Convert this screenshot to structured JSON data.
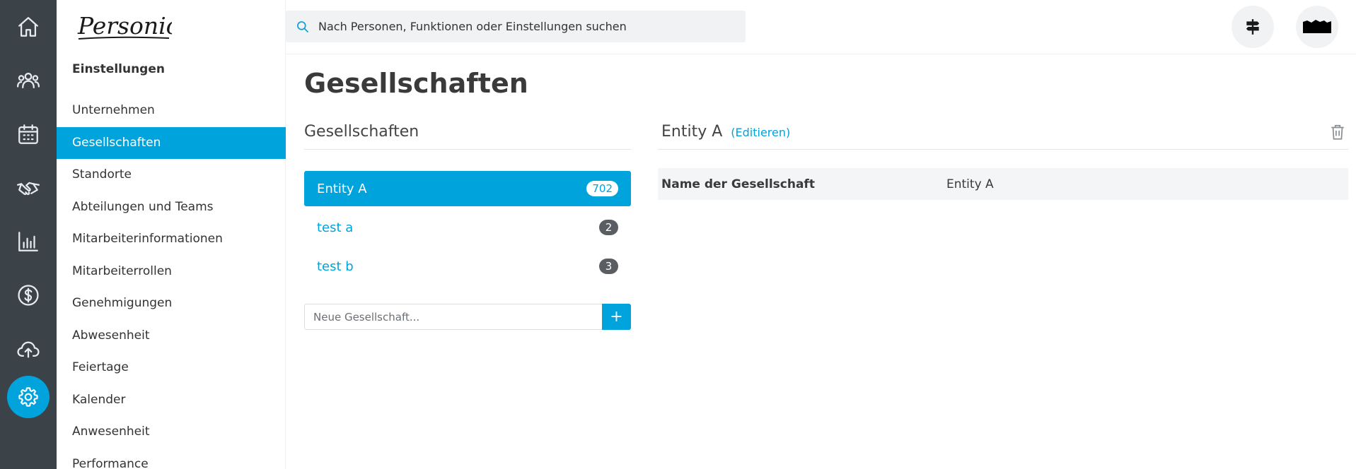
{
  "brand": {
    "name": "Personio"
  },
  "rail": [
    {
      "icon": "home-icon"
    },
    {
      "icon": "people-icon"
    },
    {
      "icon": "calendar-icon"
    },
    {
      "icon": "handshake-icon"
    },
    {
      "icon": "bar-chart-icon"
    },
    {
      "icon": "dollar-icon"
    },
    {
      "icon": "cloud-upload-icon"
    },
    {
      "icon": "gear-icon",
      "active": true
    }
  ],
  "sidebar": {
    "title": "Einstellungen",
    "items": [
      {
        "label": "Unternehmen"
      },
      {
        "label": "Gesellschaften",
        "active": true
      },
      {
        "label": "Standorte"
      },
      {
        "label": "Abteilungen und Teams"
      },
      {
        "label": "Mitarbeiterinformationen"
      },
      {
        "label": "Mitarbeiterrollen"
      },
      {
        "label": "Genehmigungen"
      },
      {
        "label": "Abwesenheit"
      },
      {
        "label": "Feiertage"
      },
      {
        "label": "Kalender"
      },
      {
        "label": "Anwesenheit"
      },
      {
        "label": "Performance"
      }
    ]
  },
  "search": {
    "placeholder": "Nach Personen, Funktionen oder Einstellungen suchen"
  },
  "header": {
    "icons": [
      "signpost-icon",
      "avatar"
    ]
  },
  "main": {
    "title": "Gesellschaften",
    "list_heading": "Gesellschaften",
    "entities": [
      {
        "name": "Entity A",
        "count": "702",
        "active": true
      },
      {
        "name": "test a",
        "count": "2"
      },
      {
        "name": "test b",
        "count": "3"
      }
    ],
    "new_placeholder": "Neue Gesellschaft...",
    "add_label": "+",
    "detail": {
      "title": "Entity A",
      "edit_label": "(Editieren)",
      "field_label": "Name der Gesellschaft",
      "field_value": "Entity A"
    }
  },
  "colors": {
    "accent": "#00a3dc",
    "rail_bg": "#3b4248",
    "badge": "#5a5e63"
  }
}
